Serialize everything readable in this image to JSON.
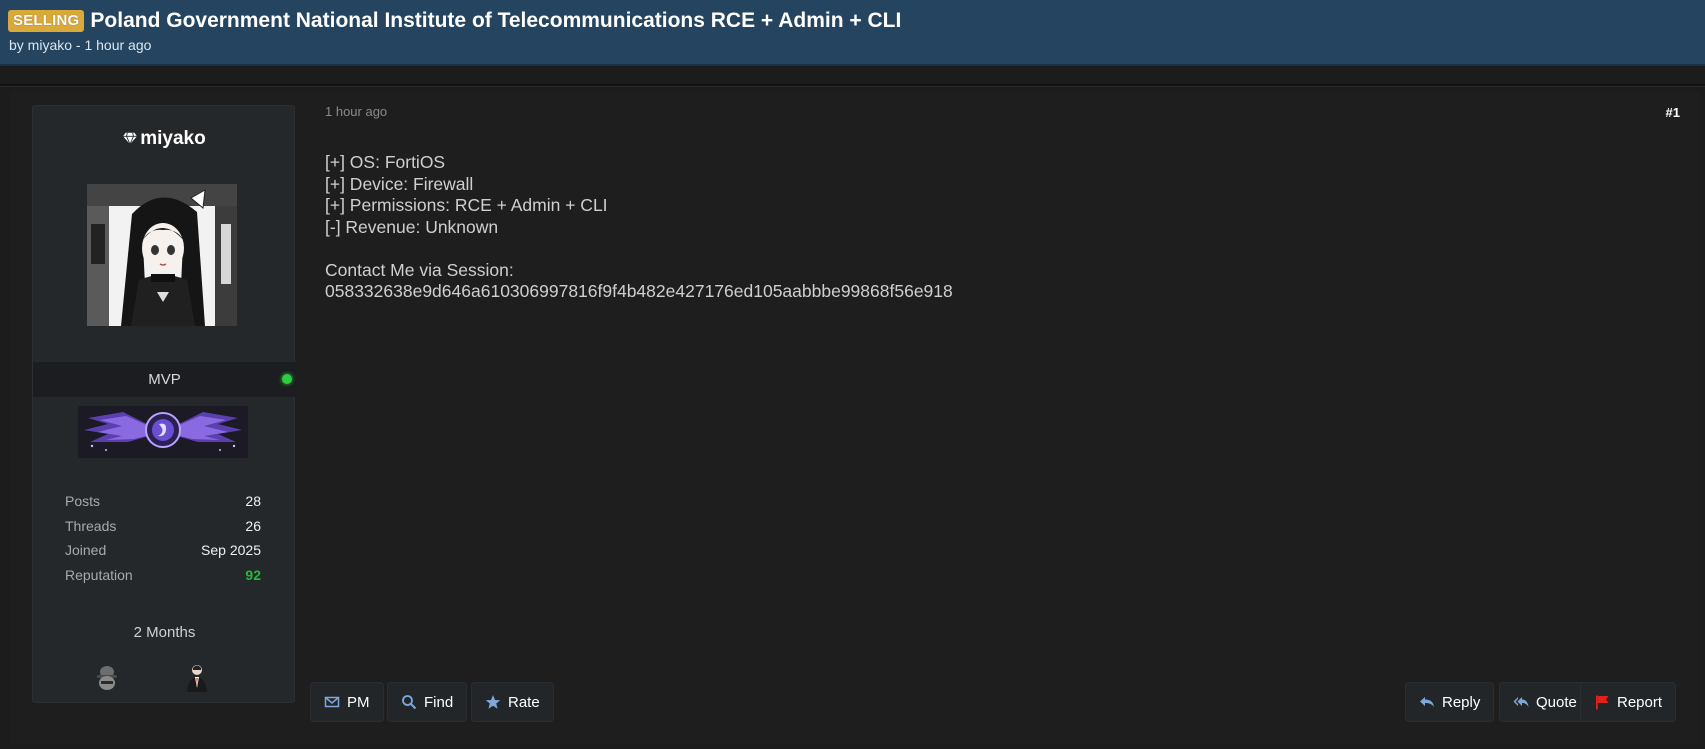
{
  "thread": {
    "prefix": "SELLING",
    "title": "Poland Government National Institute of Telecommunications RCE + Admin + CLI",
    "meta": "by miyako - 1 hour ago"
  },
  "author": {
    "username": "miyako",
    "rank": "MVP",
    "status": "online",
    "stats": [
      {
        "label": "Posts",
        "value": "28"
      },
      {
        "label": "Threads",
        "value": "26"
      },
      {
        "label": "Joined",
        "value": "Sep 2025"
      },
      {
        "label": "Reputation",
        "value": "92"
      }
    ],
    "membership": "2 Months",
    "awards": [
      "spy-hat-icon",
      "suit-agent-icon"
    ]
  },
  "post": {
    "date": "1 hour ago",
    "number": "#1",
    "lines": [
      "[+] OS: FortiOS",
      "[+] Device: Firewall",
      "[+] Permissions: RCE + Admin + CLI",
      "[-] Revenue: Unknown",
      "",
      "Contact Me via Session:",
      "058332638e9d646a610306997816f9f4b482e427176ed105aabbbe99868f56e918"
    ]
  },
  "actions": {
    "pm": "PM",
    "find": "Find",
    "rate": "Rate",
    "reply": "Reply",
    "quote": "Quote",
    "report": "Report"
  },
  "colors": {
    "header": "#24445f",
    "prefix_badge": "#d9a93a",
    "reputation": "#26b83a",
    "online": "#2ecc40",
    "report_flag": "#e0201c"
  }
}
